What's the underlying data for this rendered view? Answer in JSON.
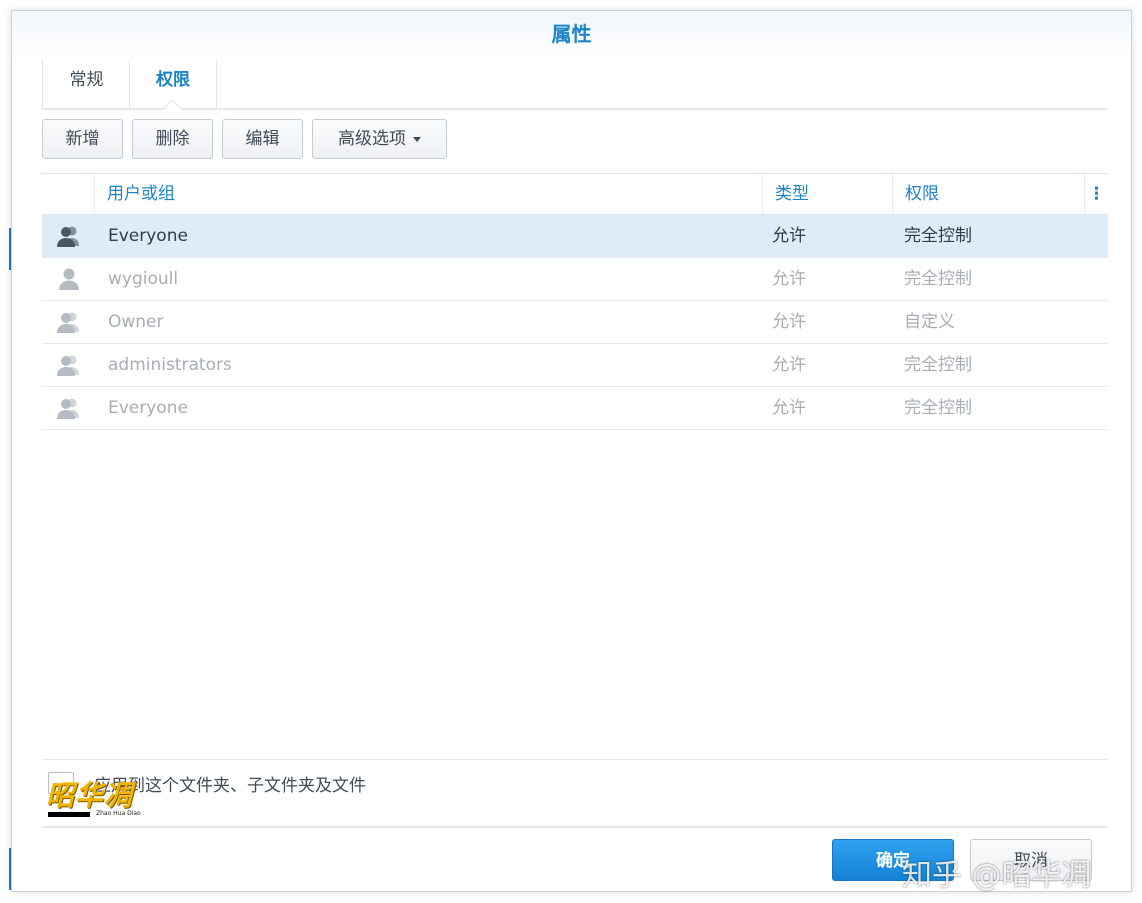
{
  "window": {
    "title": "属性"
  },
  "tabs": [
    {
      "label": "常规",
      "active": false
    },
    {
      "label": "权限",
      "active": true
    }
  ],
  "toolbar": {
    "add_label": "新增",
    "delete_label": "删除",
    "edit_label": "编辑",
    "advanced_label": "高级选项"
  },
  "grid": {
    "columns": {
      "user": "用户或组",
      "type": "类型",
      "permission": "权限",
      "menu": "⋮"
    },
    "rows": [
      {
        "icon": "group-icon",
        "user": "Everyone",
        "type": "允许",
        "permission": "完全控制",
        "selected": true
      },
      {
        "icon": "user-icon",
        "user": "wygioull",
        "type": "允许",
        "permission": "完全控制",
        "selected": false
      },
      {
        "icon": "group-icon",
        "user": "Owner",
        "type": "允许",
        "permission": "自定义",
        "selected": false
      },
      {
        "icon": "group-icon",
        "user": "administrators",
        "type": "允许",
        "permission": "完全控制",
        "selected": false
      },
      {
        "icon": "group-icon",
        "user": "Everyone",
        "type": "允许",
        "permission": "完全控制",
        "selected": false
      }
    ]
  },
  "apply": {
    "label": "应用到这个文件夹、子文件夹及文件"
  },
  "logo": {
    "text": "昭华凋",
    "subtitle": "Zhao Hua Diao"
  },
  "footer": {
    "ok_label": "确定",
    "cancel_label": "取消",
    "watermark": "知乎 @昭华凋"
  },
  "colors": {
    "accent": "#1b85c7",
    "selected_row": "#dcecf9",
    "ok_button": "#1f8fe3"
  }
}
